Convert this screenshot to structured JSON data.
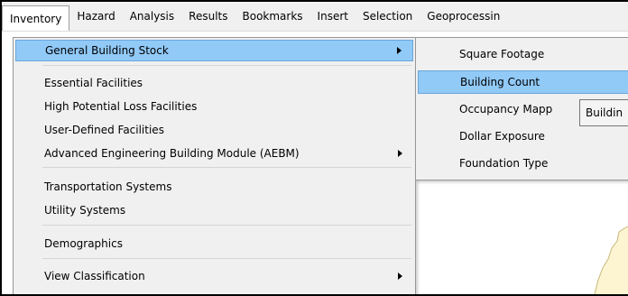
{
  "menubar": {
    "items": [
      {
        "label": "Inventory"
      },
      {
        "label": "Hazard"
      },
      {
        "label": "Analysis"
      },
      {
        "label": "Results"
      },
      {
        "label": "Bookmarks"
      },
      {
        "label": "Insert"
      },
      {
        "label": "Selection"
      },
      {
        "label": "Geoprocessin"
      }
    ]
  },
  "dropdown": {
    "items": [
      {
        "label": "General Building Stock",
        "has_submenu": true,
        "highlighted": true
      },
      {
        "label": "Essential Facilities"
      },
      {
        "label": "High Potential Loss Facilities"
      },
      {
        "label": "User-Defined Facilities"
      },
      {
        "label": "Advanced Engineering Building Module (AEBM)",
        "has_submenu": true
      },
      {
        "label": "Transportation Systems"
      },
      {
        "label": "Utility Systems"
      },
      {
        "label": "Demographics"
      },
      {
        "label": "View Classification",
        "has_submenu": true
      }
    ]
  },
  "submenu": {
    "items": [
      {
        "label": "Square Footage"
      },
      {
        "label": "Building Count",
        "highlighted": true
      },
      {
        "label": "Occupancy Mapp"
      },
      {
        "label": "Dollar Exposure"
      },
      {
        "label": "Foundation Type"
      }
    ]
  },
  "tooltip": {
    "text": "Buildin"
  },
  "colors": {
    "highlight": "#91c9f7",
    "map_fill": "#fdf5d2"
  }
}
